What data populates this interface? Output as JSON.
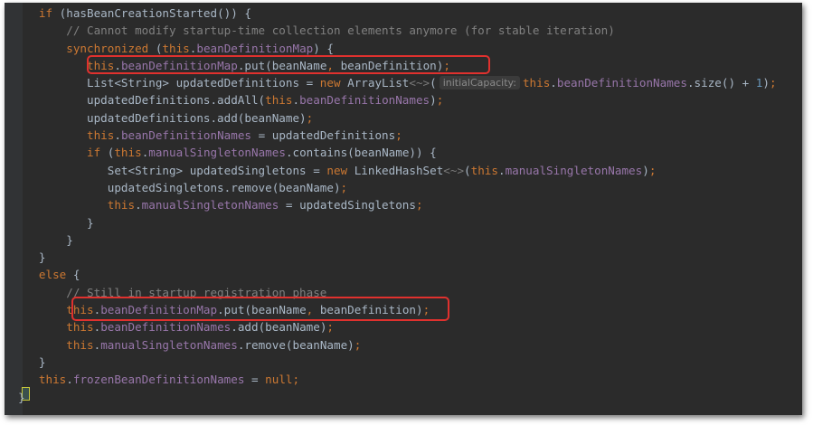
{
  "editor": {
    "lines": [
      {
        "indent": 5,
        "tokens": [
          {
            "t": "if",
            "c": "kw"
          },
          {
            "t": " (hasBeanCreationStarted()) {"
          }
        ]
      },
      {
        "indent": 9,
        "tokens": [
          {
            "t": "// Cannot modify startup-time collection elements anymore (for stable iteration)",
            "c": "cmt"
          }
        ]
      },
      {
        "indent": 9,
        "tokens": [
          {
            "t": "synchronized",
            "c": "kw"
          },
          {
            "t": " ("
          },
          {
            "t": "this",
            "c": "kw"
          },
          {
            "t": "."
          },
          {
            "t": "beanDefinitionMap",
            "c": "fld"
          },
          {
            "t": ") {"
          }
        ]
      },
      {
        "indent": 12,
        "tokens": [
          {
            "t": "this",
            "c": "kw"
          },
          {
            "t": "."
          },
          {
            "t": "beanDefinitionMap",
            "c": "fld"
          },
          {
            "t": ".put(beanName"
          },
          {
            "t": ",",
            "c": "kw"
          },
          {
            "t": " beanDefinition)"
          },
          {
            "t": ";",
            "c": "kw"
          }
        ]
      },
      {
        "indent": 12,
        "tokens": [
          {
            "t": "List<String> updatedDefinitions = "
          },
          {
            "t": "new",
            "c": "kw"
          },
          {
            "t": " ArrayList"
          },
          {
            "t": "<~>",
            "c": "diam"
          },
          {
            "t": "("
          },
          {
            "t": "initialCapacity:",
            "c": "hint"
          },
          {
            "t": "this",
            "c": "kw"
          },
          {
            "t": "."
          },
          {
            "t": "beanDefinitionNames",
            "c": "fld"
          },
          {
            "t": ".size() + "
          },
          {
            "t": "1",
            "c": "num"
          },
          {
            "t": ")"
          },
          {
            "t": ";",
            "c": "kw"
          }
        ]
      },
      {
        "indent": 12,
        "tokens": [
          {
            "t": "updatedDefinitions.addAll("
          },
          {
            "t": "this",
            "c": "kw"
          },
          {
            "t": "."
          },
          {
            "t": "beanDefinitionNames",
            "c": "fld"
          },
          {
            "t": ")"
          },
          {
            "t": ";",
            "c": "kw"
          }
        ]
      },
      {
        "indent": 12,
        "tokens": [
          {
            "t": "updatedDefinitions.add(beanName)"
          },
          {
            "t": ";",
            "c": "kw"
          }
        ]
      },
      {
        "indent": 12,
        "tokens": [
          {
            "t": "this",
            "c": "kw"
          },
          {
            "t": "."
          },
          {
            "t": "beanDefinitionNames",
            "c": "fld"
          },
          {
            "t": " = updatedDefinitions"
          },
          {
            "t": ";",
            "c": "kw"
          }
        ]
      },
      {
        "indent": 12,
        "tokens": [
          {
            "t": "if",
            "c": "kw"
          },
          {
            "t": " ("
          },
          {
            "t": "this",
            "c": "kw"
          },
          {
            "t": "."
          },
          {
            "t": "manualSingletonNames",
            "c": "fld"
          },
          {
            "t": ".contains(beanName)) {"
          }
        ]
      },
      {
        "indent": 15,
        "tokens": [
          {
            "t": "Set<String> updatedSingletons = "
          },
          {
            "t": "new",
            "c": "kw"
          },
          {
            "t": " LinkedHashSet"
          },
          {
            "t": "<~>",
            "c": "diam"
          },
          {
            "t": "("
          },
          {
            "t": "this",
            "c": "kw"
          },
          {
            "t": "."
          },
          {
            "t": "manualSingletonNames",
            "c": "fld"
          },
          {
            "t": ")"
          },
          {
            "t": ";",
            "c": "kw"
          }
        ]
      },
      {
        "indent": 15,
        "tokens": [
          {
            "t": "updatedSingletons.remove(beanName)"
          },
          {
            "t": ";",
            "c": "kw"
          }
        ]
      },
      {
        "indent": 15,
        "tokens": [
          {
            "t": "this",
            "c": "kw"
          },
          {
            "t": "."
          },
          {
            "t": "manualSingletonNames",
            "c": "fld"
          },
          {
            "t": " = updatedSingletons"
          },
          {
            "t": ";",
            "c": "kw"
          }
        ]
      },
      {
        "indent": 12,
        "tokens": [
          {
            "t": "}"
          }
        ]
      },
      {
        "indent": 9,
        "tokens": [
          {
            "t": "}"
          }
        ]
      },
      {
        "indent": 5,
        "tokens": [
          {
            "t": "}"
          }
        ]
      },
      {
        "indent": 5,
        "tokens": [
          {
            "t": "else",
            "c": "kw"
          },
          {
            "t": " {"
          }
        ]
      },
      {
        "indent": 9,
        "tokens": [
          {
            "t": "// Still in startup registration phase",
            "c": "cmt"
          }
        ]
      },
      {
        "indent": 9,
        "tokens": [
          {
            "t": "this",
            "c": "kw"
          },
          {
            "t": "."
          },
          {
            "t": "beanDefinitionMap",
            "c": "fld"
          },
          {
            "t": ".put(beanName"
          },
          {
            "t": ",",
            "c": "kw"
          },
          {
            "t": " beanDefinition)"
          },
          {
            "t": ";",
            "c": "kw"
          }
        ]
      },
      {
        "indent": 9,
        "tokens": [
          {
            "t": "this",
            "c": "kw"
          },
          {
            "t": "."
          },
          {
            "t": "beanDefinitionNames",
            "c": "fld"
          },
          {
            "t": ".add(beanName)"
          },
          {
            "t": ";",
            "c": "kw"
          }
        ]
      },
      {
        "indent": 9,
        "tokens": [
          {
            "t": "this",
            "c": "kw"
          },
          {
            "t": "."
          },
          {
            "t": "manualSingletonNames",
            "c": "fld"
          },
          {
            "t": ".remove(beanName)"
          },
          {
            "t": ";",
            "c": "kw"
          }
        ]
      },
      {
        "indent": 5,
        "tokens": [
          {
            "t": "}"
          }
        ]
      },
      {
        "indent": 5,
        "tokens": [
          {
            "t": "this",
            "c": "kw"
          },
          {
            "t": "."
          },
          {
            "t": "frozenBeanDefinitionNames",
            "c": "fld"
          },
          {
            "t": " = "
          },
          {
            "t": "null",
            "c": "kw"
          },
          {
            "t": ";",
            "c": "kw"
          }
        ]
      },
      {
        "indent": 2,
        "tokens": [
          {
            "t": "}"
          }
        ]
      }
    ],
    "colors": {
      "background": "#2b2b2b",
      "default_text": "#a9b7c6",
      "keyword": "#cc7832",
      "field": "#9876aa",
      "comment": "#808080",
      "number": "#6897bb",
      "highlight_box": "#e0312e"
    }
  }
}
